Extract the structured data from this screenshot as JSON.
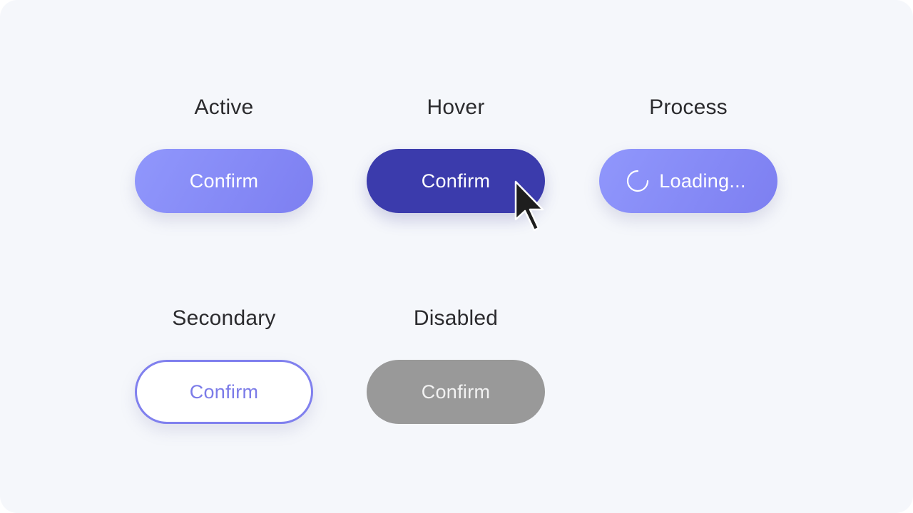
{
  "states": {
    "active": {
      "label": "Active",
      "button_label": "Confirm"
    },
    "hover": {
      "label": "Hover",
      "button_label": "Confirm"
    },
    "process": {
      "label": "Process",
      "button_label": "Loading..."
    },
    "secondary": {
      "label": "Secondary",
      "button_label": "Confirm"
    },
    "disabled": {
      "label": "Disabled",
      "button_label": "Confirm"
    }
  },
  "icons": {
    "spinner": "loading-spinner-icon",
    "cursor": "mouse-pointer-icon"
  },
  "colors": {
    "background": "#f5f7fb",
    "primary_gradient_start": "#9097fc",
    "primary_gradient_end": "#7d7ff1",
    "hover": "#3b3bac",
    "secondary_border": "#8080ee",
    "secondary_text": "#7b7be8",
    "disabled": "#999999",
    "label_text": "#2b2b2e"
  }
}
